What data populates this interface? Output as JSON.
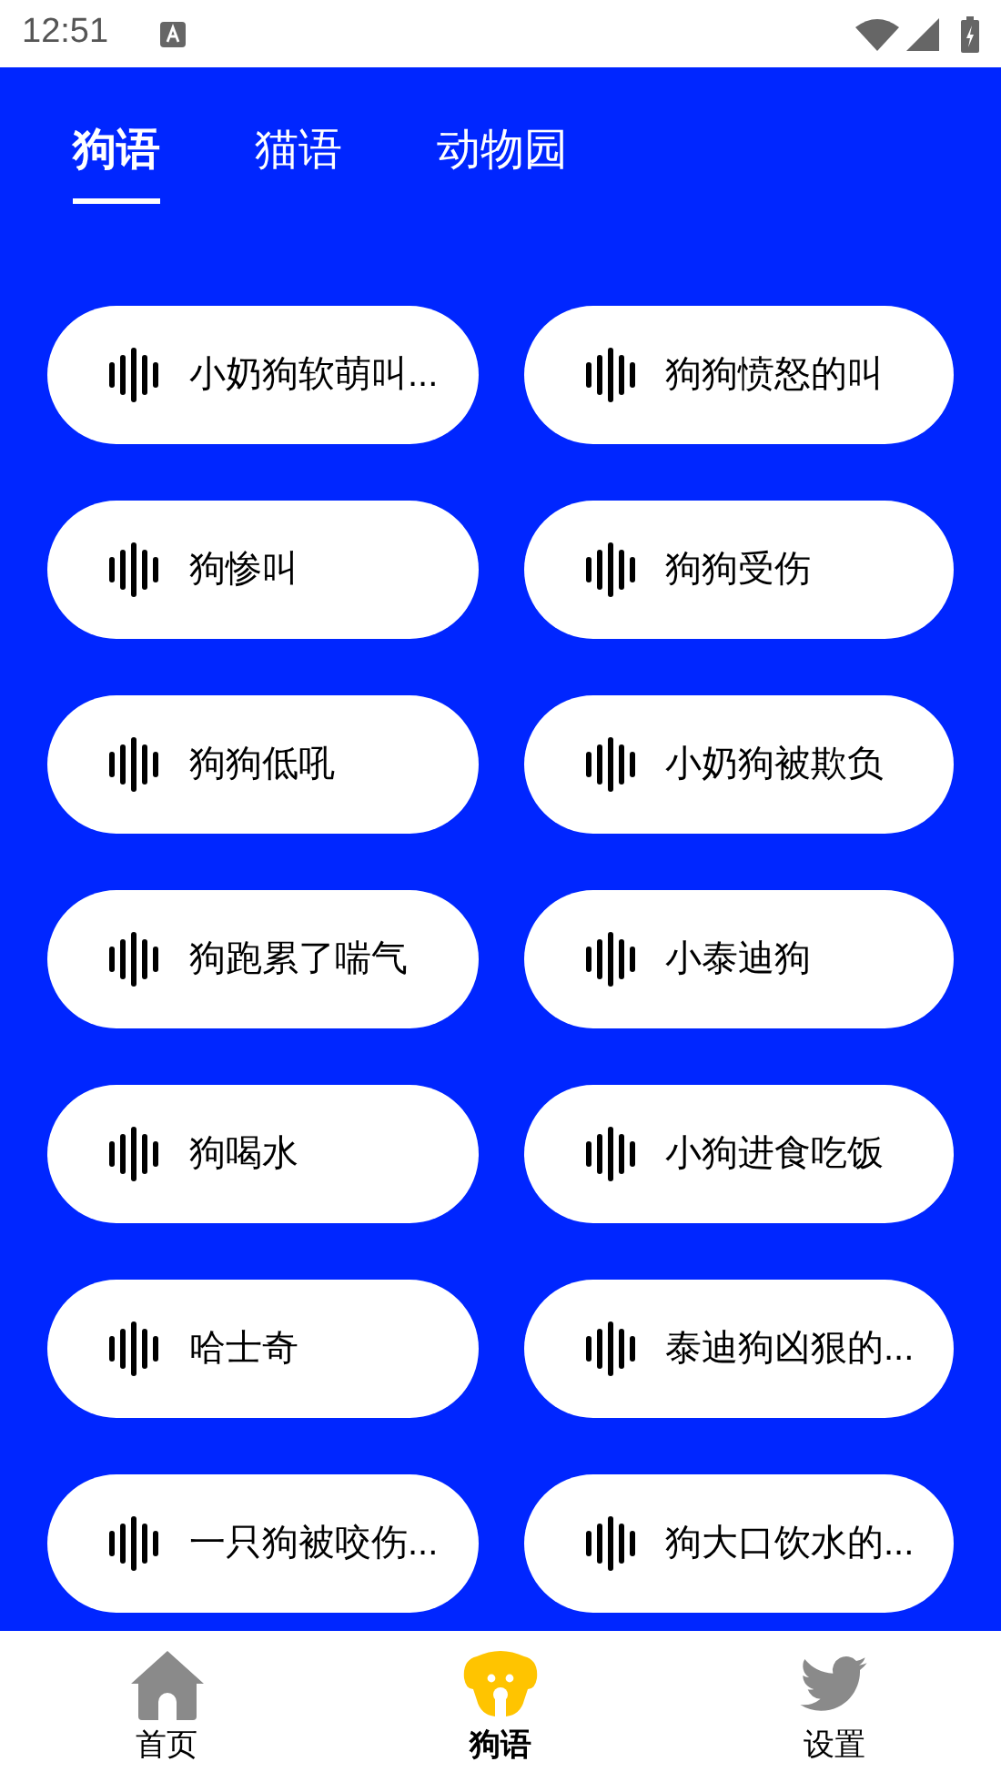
{
  "status_bar": {
    "time": "12:51"
  },
  "tabs": [
    {
      "label": "狗语",
      "selected": true
    },
    {
      "label": "猫语",
      "selected": false
    },
    {
      "label": "动物园",
      "selected": false
    }
  ],
  "sounds": [
    {
      "label": "小奶狗软萌叫..."
    },
    {
      "label": "狗狗愤怒的叫"
    },
    {
      "label": "狗惨叫"
    },
    {
      "label": "狗狗受伤"
    },
    {
      "label": "狗狗低吼"
    },
    {
      "label": "小奶狗被欺负"
    },
    {
      "label": "狗跑累了喘气"
    },
    {
      "label": "小泰迪狗"
    },
    {
      "label": "狗喝水"
    },
    {
      "label": "小狗进食吃饭"
    },
    {
      "label": "哈士奇"
    },
    {
      "label": "泰迪狗凶狠的..."
    },
    {
      "label": "一只狗被咬伤..."
    },
    {
      "label": "狗大口饮水的..."
    }
  ],
  "bottom_nav": [
    {
      "label": "首页",
      "kind": "home",
      "selected": false
    },
    {
      "label": "狗语",
      "kind": "dog",
      "selected": true
    },
    {
      "label": "设置",
      "kind": "bird",
      "selected": false
    }
  ]
}
